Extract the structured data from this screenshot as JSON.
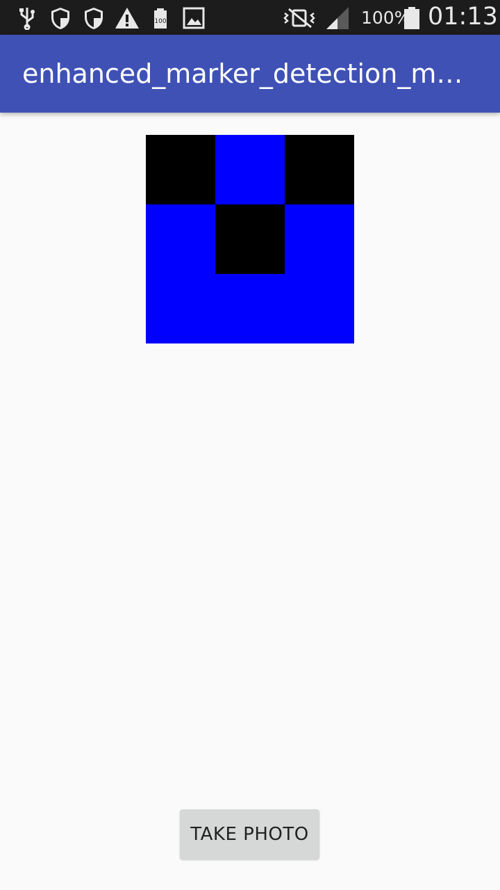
{
  "status_bar": {
    "icons": [
      "usb-icon",
      "shield-icon",
      "shield-icon",
      "warning-icon",
      "battery-100-icon",
      "image-icon",
      "vibrate-icon",
      "signal-icon",
      "battery-icon"
    ],
    "battery_percent": "100%",
    "battery_small_label": "100",
    "clock": "01:13"
  },
  "app_bar": {
    "title": "enhanced_marker_detection_mob…",
    "color": "#3f51b5"
  },
  "marker": {
    "rows": [
      [
        "black",
        "blue",
        "black"
      ],
      [
        "blue",
        "black",
        "blue"
      ],
      [
        "blue",
        "blue",
        "blue"
      ]
    ],
    "colors": {
      "black": "#000000",
      "blue": "#0000ff"
    }
  },
  "actions": {
    "take_photo_label": "TAKE PHOTO"
  }
}
